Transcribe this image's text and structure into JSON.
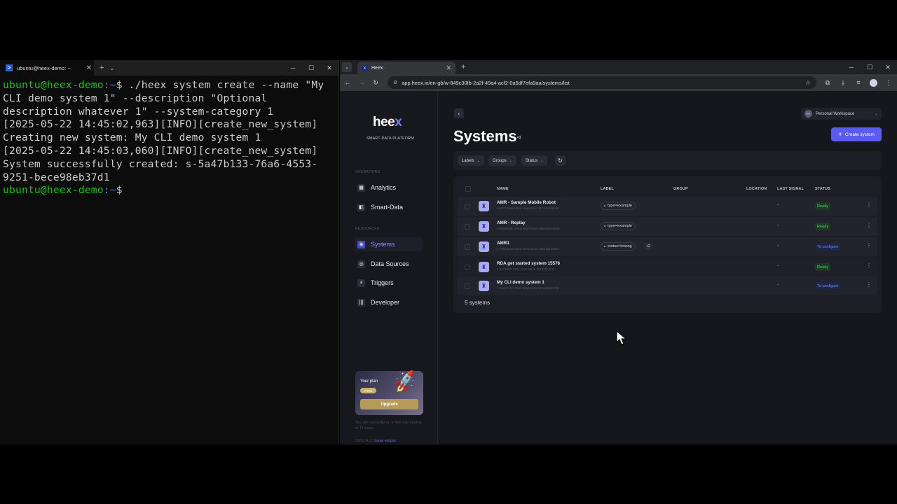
{
  "terminal": {
    "tab_title": "ubuntu@heex-demo: ~",
    "tab_icon": "powershell-icon",
    "new_tab": "+",
    "dropdown": "⌄",
    "win": {
      "min": "─",
      "max": "☐",
      "close": "✕"
    },
    "lines": [
      {
        "user": "ubuntu@heex-demo",
        "path": ":~",
        "cmd": "$ ./heex system create --name \"My CLI demo system 1\" --description \"Optional description whatever 1\" --system-category 1"
      },
      {
        "text": "[2025-05-22 14:45:02,963][INFO][create_new_system] Creating new system: My CLI demo system 1"
      },
      {
        "text": "[2025-05-22 14:45:03,060][INFO][create_new_system] System successfully created: s-5a47b133-76a6-4553-9251-bece98eb37d1"
      },
      {
        "user": "ubuntu@heex-demo",
        "path": ":~",
        "cmd": "$ "
      }
    ]
  },
  "browser": {
    "tab_title": "Heex",
    "url": "app.heex.io/en-gb/w-849c30fb-2a2f-49a4-acf2-0a5df7efa9aa/systems/list",
    "win": {
      "min": "─",
      "max": "☐",
      "close": "✕"
    }
  },
  "sidebar": {
    "logo_main": "hee",
    "logo_x": "x",
    "logo_sub": "SMART-DATA PLATFORM",
    "section_operations": "OPERATIONS",
    "section_resources": "RESOURCES",
    "items": [
      {
        "label": "Analytics",
        "icon": "analytics-icon"
      },
      {
        "label": "Smart-Data",
        "icon": "smart-data-icon"
      },
      {
        "label": "Systems",
        "icon": "systems-icon"
      },
      {
        "label": "Data Sources",
        "icon": "data-sources-icon"
      },
      {
        "label": "Triggers",
        "icon": "triggers-icon"
      },
      {
        "label": "Developer",
        "icon": "developer-icon"
      }
    ],
    "plan": {
      "title": "Your plan",
      "badge": "FREE",
      "upgrade": "Upgrade"
    },
    "trial_text": "You are currently on a free trial ending in 11 days.",
    "version": "2025.04.2",
    "separator": "|",
    "legal": "Legal notices"
  },
  "main": {
    "workspace": {
      "initials": "EP",
      "name": "Personal Workspace"
    },
    "title": "Systems",
    "create_button": "Create system",
    "filters": [
      "Labels",
      "Groups",
      "Status"
    ],
    "columns": [
      "NAME",
      "LABEL",
      "GROUP",
      "LOCATION",
      "LAST SIGNAL",
      "STATUS"
    ],
    "rows": [
      {
        "name": "AMR - Sample Mobile Robot",
        "id": "s-a0774868-09e9-49ea-8eb7-5f113b664635",
        "label": "type=example",
        "extra": "",
        "signal": "-",
        "status": "Ready",
        "status_type": "ready"
      },
      {
        "name": "AMR - Replay",
        "id": "s-69e25e8c-d4ed-4b8d-9b0d-2a89a6e94699",
        "label": "type=example",
        "extra": "",
        "signal": "-",
        "status": "Ready",
        "status_type": "ready"
      },
      {
        "name": "AMR1",
        "id": "s-735bab09-eac6-407b-a14b-cb021d166557",
        "label": "status=tetsing",
        "extra": "+2",
        "signal": "-",
        "status": "To configure",
        "status_type": "config"
      },
      {
        "name": "RDA get started system 15576",
        "id": "s-8a73686-724a-4c4c-956b-f290c9fc4f41",
        "label": "",
        "extra": "",
        "signal": "-",
        "status": "Ready",
        "status_type": "ready"
      },
      {
        "name": "My CLI demo system 1",
        "id": "s-5a47b133-76a6-4553-9251-bece98eb37d1",
        "label": "",
        "extra": "",
        "signal": "-",
        "status": "To configure",
        "status_type": "config"
      }
    ],
    "count_text": "5 systems"
  }
}
